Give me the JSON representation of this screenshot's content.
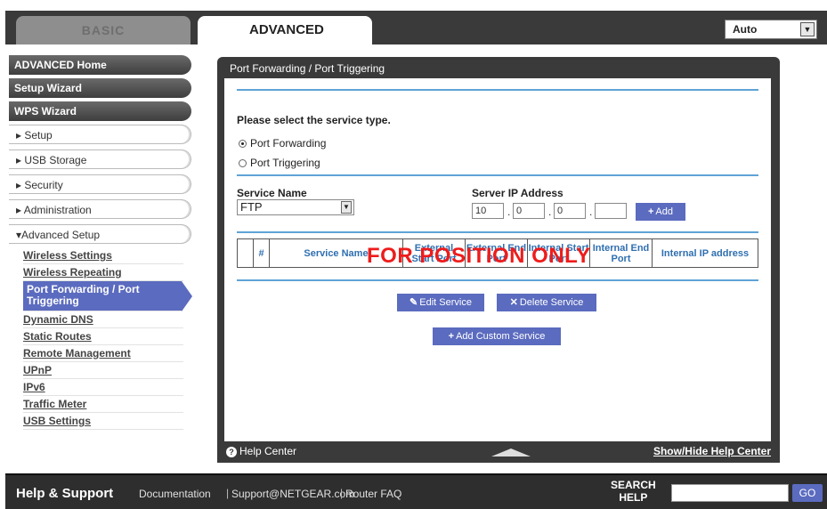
{
  "tabs": {
    "basic": "BASIC",
    "advanced": "ADVANCED"
  },
  "language_select": {
    "value": "Auto"
  },
  "sidebar": {
    "main_items": [
      "ADVANCED Home",
      "Setup Wizard",
      "WPS Wizard"
    ],
    "sections": [
      "▸ Setup",
      "▸ USB Storage",
      "▸ Security",
      "▸ Administration",
      "▾Advanced Setup"
    ],
    "advanced_setup_items": [
      "Wireless Settings",
      "Wireless Repeating",
      "Port Forwarding / Port Triggering",
      "Dynamic DNS",
      "Static Routes",
      "Remote Management",
      "UPnP",
      "IPv6",
      "Traffic Meter",
      "USB Settings"
    ]
  },
  "panel": {
    "title": "Port Forwarding / Port Triggering",
    "select_prompt": "Please select the service type.",
    "radio_port_forwarding": "Port Forwarding",
    "radio_port_triggering": "Port Triggering",
    "service_name_label": "Service Name",
    "service_name_value": "FTP",
    "server_ip_label": "Server IP Address",
    "ip": [
      "10",
      "0",
      "0",
      ""
    ],
    "add_button": "Add",
    "table_headers": [
      "",
      "#",
      "Service Name",
      "External Start Port",
      "External End Port",
      "Internal Start Port",
      "Internal End Port",
      "Internal IP address"
    ],
    "overlay_text": "FOR POSITION ONLY",
    "edit_service": "Edit Service",
    "delete_service": "Delete Service",
    "add_custom_service": "Add Custom Service"
  },
  "helpbar": {
    "help_center": "Help Center",
    "show_hide": "Show/Hide Help Center"
  },
  "footer": {
    "title": "Help & Support",
    "documentation": "Documentation",
    "support_email": "Support@NETGEAR.com",
    "router_faq": "Router FAQ",
    "search_label_1": "SEARCH",
    "search_label_2": "HELP",
    "go": "GO"
  },
  "colors": {
    "accent_blue": "#5b6bbf",
    "rule_blue": "#5fa3d6",
    "overlay_red": "#ee1c1c",
    "dark_bar": "#3a3a3a"
  }
}
